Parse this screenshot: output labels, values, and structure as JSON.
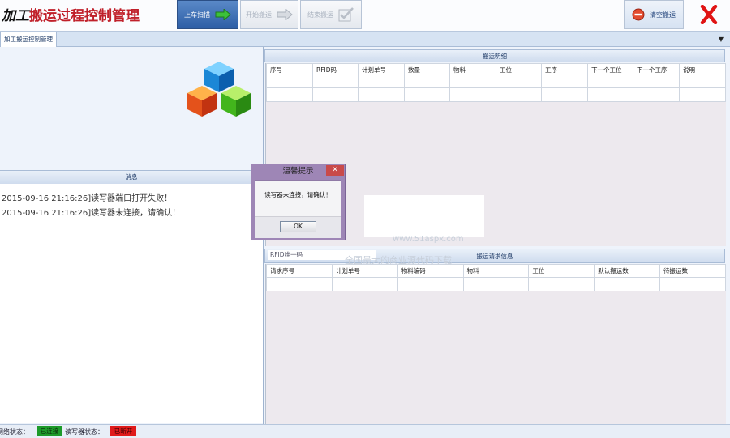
{
  "header": {
    "title_prefix": "加工",
    "title_main": "搬运过程控制管理",
    "buttons": {
      "scan": "上车扫描",
      "start": "开始搬运",
      "end": "结束搬运",
      "clear": "清空搬运"
    }
  },
  "tabs": [
    {
      "label": "加工搬运控制管理"
    }
  ],
  "messages": {
    "header": "消息",
    "lines": [
      "2015-09-16 21:16:26]读写器端口打开失败！",
      "2015-09-16 21:16:26]读写器未连接，请确认！"
    ]
  },
  "detail": {
    "header": "搬运明细",
    "columns": [
      "序号",
      "RFID码",
      "计划单号",
      "数量",
      "物料",
      "工位",
      "工序",
      "下一个工位",
      "下一个工序",
      "说明"
    ]
  },
  "request": {
    "rfid_placeholder": "RFID唯一码",
    "header": "搬运请求信息",
    "columns": [
      "请求序号",
      "计划单号",
      "物料编码",
      "物料",
      "工位",
      "默认搬运数",
      "待搬运数"
    ]
  },
  "status": {
    "network_label": "网络状态：",
    "network_value": "已连接",
    "network_color": "#1d9b2a",
    "reader_label": "读写器状态：",
    "reader_value": "已断开",
    "reader_color": "#e01b1b"
  },
  "dialog": {
    "title": "温馨提示",
    "message": "读写器未连接，请确认！",
    "ok_label": "OK"
  },
  "watermark": {
    "url": "www.51aspx.com",
    "text": "全国最大的商业源代码下载"
  },
  "icons": {
    "scan": "arrow-right-icon",
    "start": "arrow-right-icon",
    "end": "checkmark-icon",
    "clear": "no-entry-icon",
    "close": "close-icon",
    "logo": "cubes-icon"
  }
}
